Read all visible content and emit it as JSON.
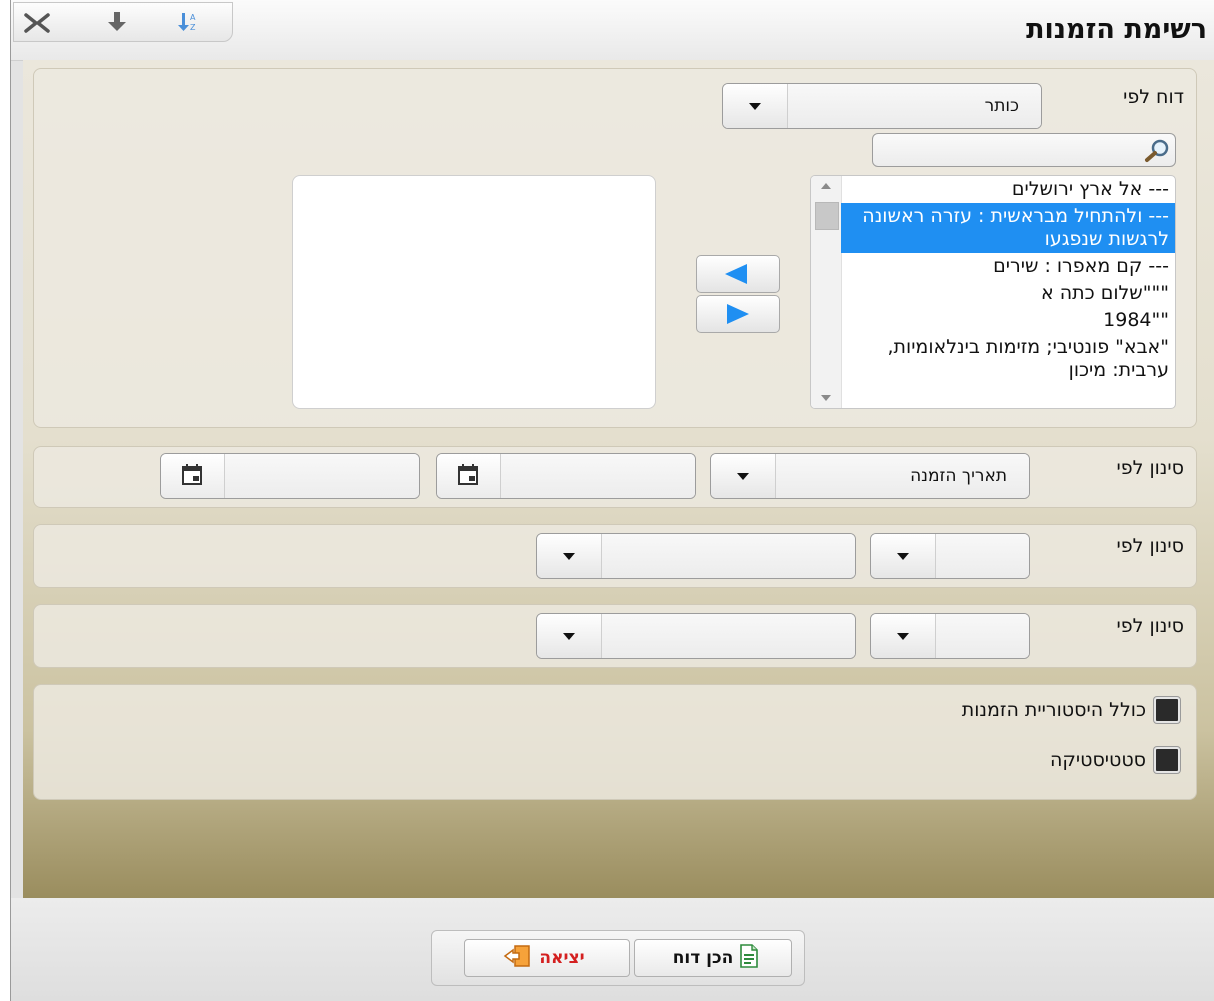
{
  "window": {
    "title": "רשימת הזמנות"
  },
  "toolbar": {
    "icons": [
      "close-icon",
      "download-icon",
      "sort-icon"
    ]
  },
  "report_by": {
    "label": "דוח לפי",
    "dropdown_value": "כותר",
    "search_placeholder": "",
    "source_items": [
      "--- אל ארץ ירושלים",
      "--- ולהתחיל מבראשית : עזרה ראשונה לרגשות שנפגעו",
      "--- קם מאפרו : שירים",
      "\"\"\"שלום כתה א",
      "\"\"1984",
      "\"אבא\" פונטיבי; מזימות בינלאומיות, ערבית: מיכון"
    ],
    "selected_index": 1
  },
  "filter_1": {
    "label": "סינון לפי",
    "dropdown_value": "תאריך הזמנה",
    "date_from": "",
    "date_to": ""
  },
  "filter_2": {
    "label": "סינון לפי",
    "field_value": "",
    "value": ""
  },
  "filter_3": {
    "label": "סינון לפי",
    "field_value": "",
    "value": ""
  },
  "options": {
    "include_history": "כולל היסטוריית הזמנות",
    "statistics": "סטטיסטיקה"
  },
  "footer": {
    "prepare_report": "הכן דוח",
    "exit": "יציאה"
  },
  "colors": {
    "selection": "#1f8ff2",
    "exit_text": "#d42020"
  }
}
